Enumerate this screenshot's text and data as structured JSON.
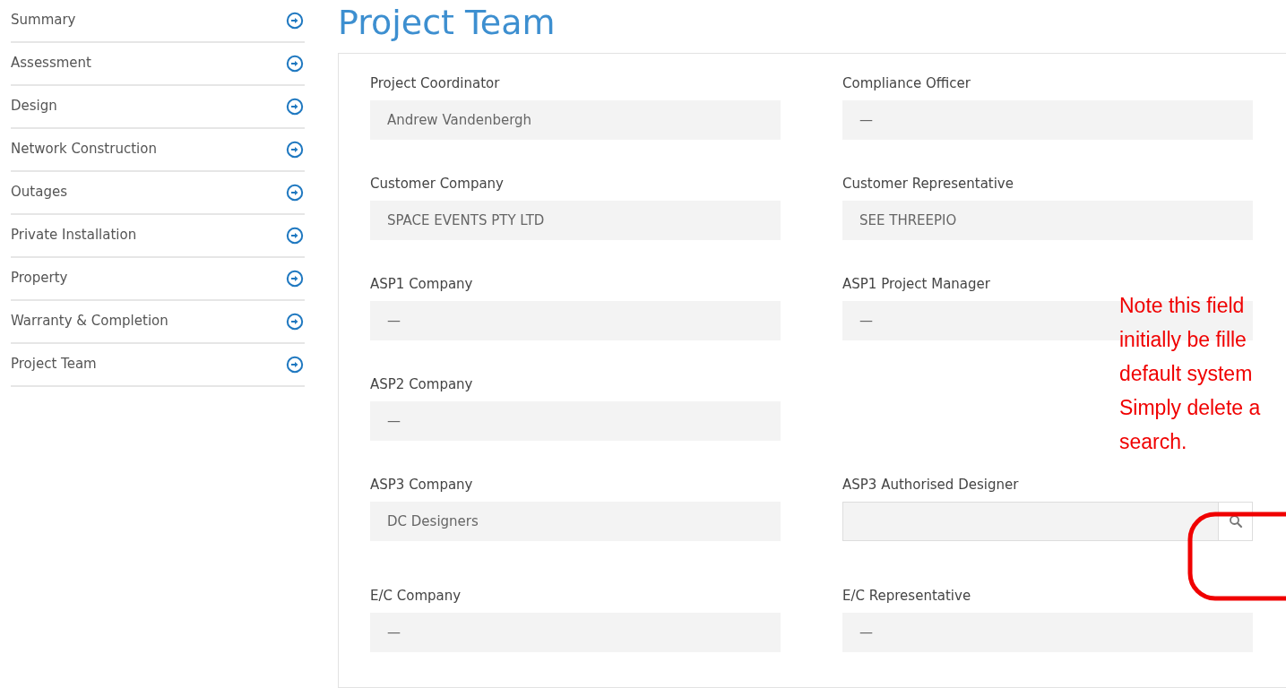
{
  "sidebar": {
    "items": [
      {
        "label": "Summary"
      },
      {
        "label": "Assessment"
      },
      {
        "label": "Design"
      },
      {
        "label": "Network Construction"
      },
      {
        "label": "Outages"
      },
      {
        "label": "Private Installation"
      },
      {
        "label": "Property"
      },
      {
        "label": "Warranty & Completion"
      },
      {
        "label": "Project Team"
      }
    ]
  },
  "page_title": "Project Team",
  "form": {
    "rows": [
      {
        "fields": [
          {
            "label": "Project Coordinator",
            "kind": "readonly",
            "value": "Andrew Vandenbergh"
          },
          {
            "label": "Compliance Officer",
            "kind": "readonly",
            "value": "—"
          }
        ]
      },
      {
        "fields": [
          {
            "label": "Customer Company",
            "kind": "readonly",
            "value": "SPACE EVENTS PTY LTD"
          },
          {
            "label": "Customer Representative",
            "kind": "readonly",
            "value": "SEE THREEPIO"
          }
        ]
      },
      {
        "fields": [
          {
            "label": "ASP1 Company",
            "kind": "readonly",
            "value": "—"
          },
          {
            "label": "ASP1 Project Manager",
            "kind": "readonly",
            "value": "—"
          }
        ]
      },
      {
        "fields": [
          {
            "label": "ASP2 Company",
            "kind": "readonly",
            "value": "—"
          }
        ]
      },
      {
        "fields": [
          {
            "label": "ASP3 Company",
            "kind": "readonly",
            "value": "DC Designers"
          },
          {
            "label": "ASP3 Authorised Designer",
            "kind": "search"
          }
        ]
      },
      {
        "fields": [
          {
            "label": "E/C Company",
            "kind": "readonly",
            "value": "—"
          },
          {
            "label": "E/C Representative",
            "kind": "readonly",
            "value": "—"
          }
        ]
      }
    ]
  },
  "annotation": {
    "lines": [
      "Note this field",
      "initially be fille",
      "default system",
      "Simply delete a",
      "search."
    ]
  }
}
